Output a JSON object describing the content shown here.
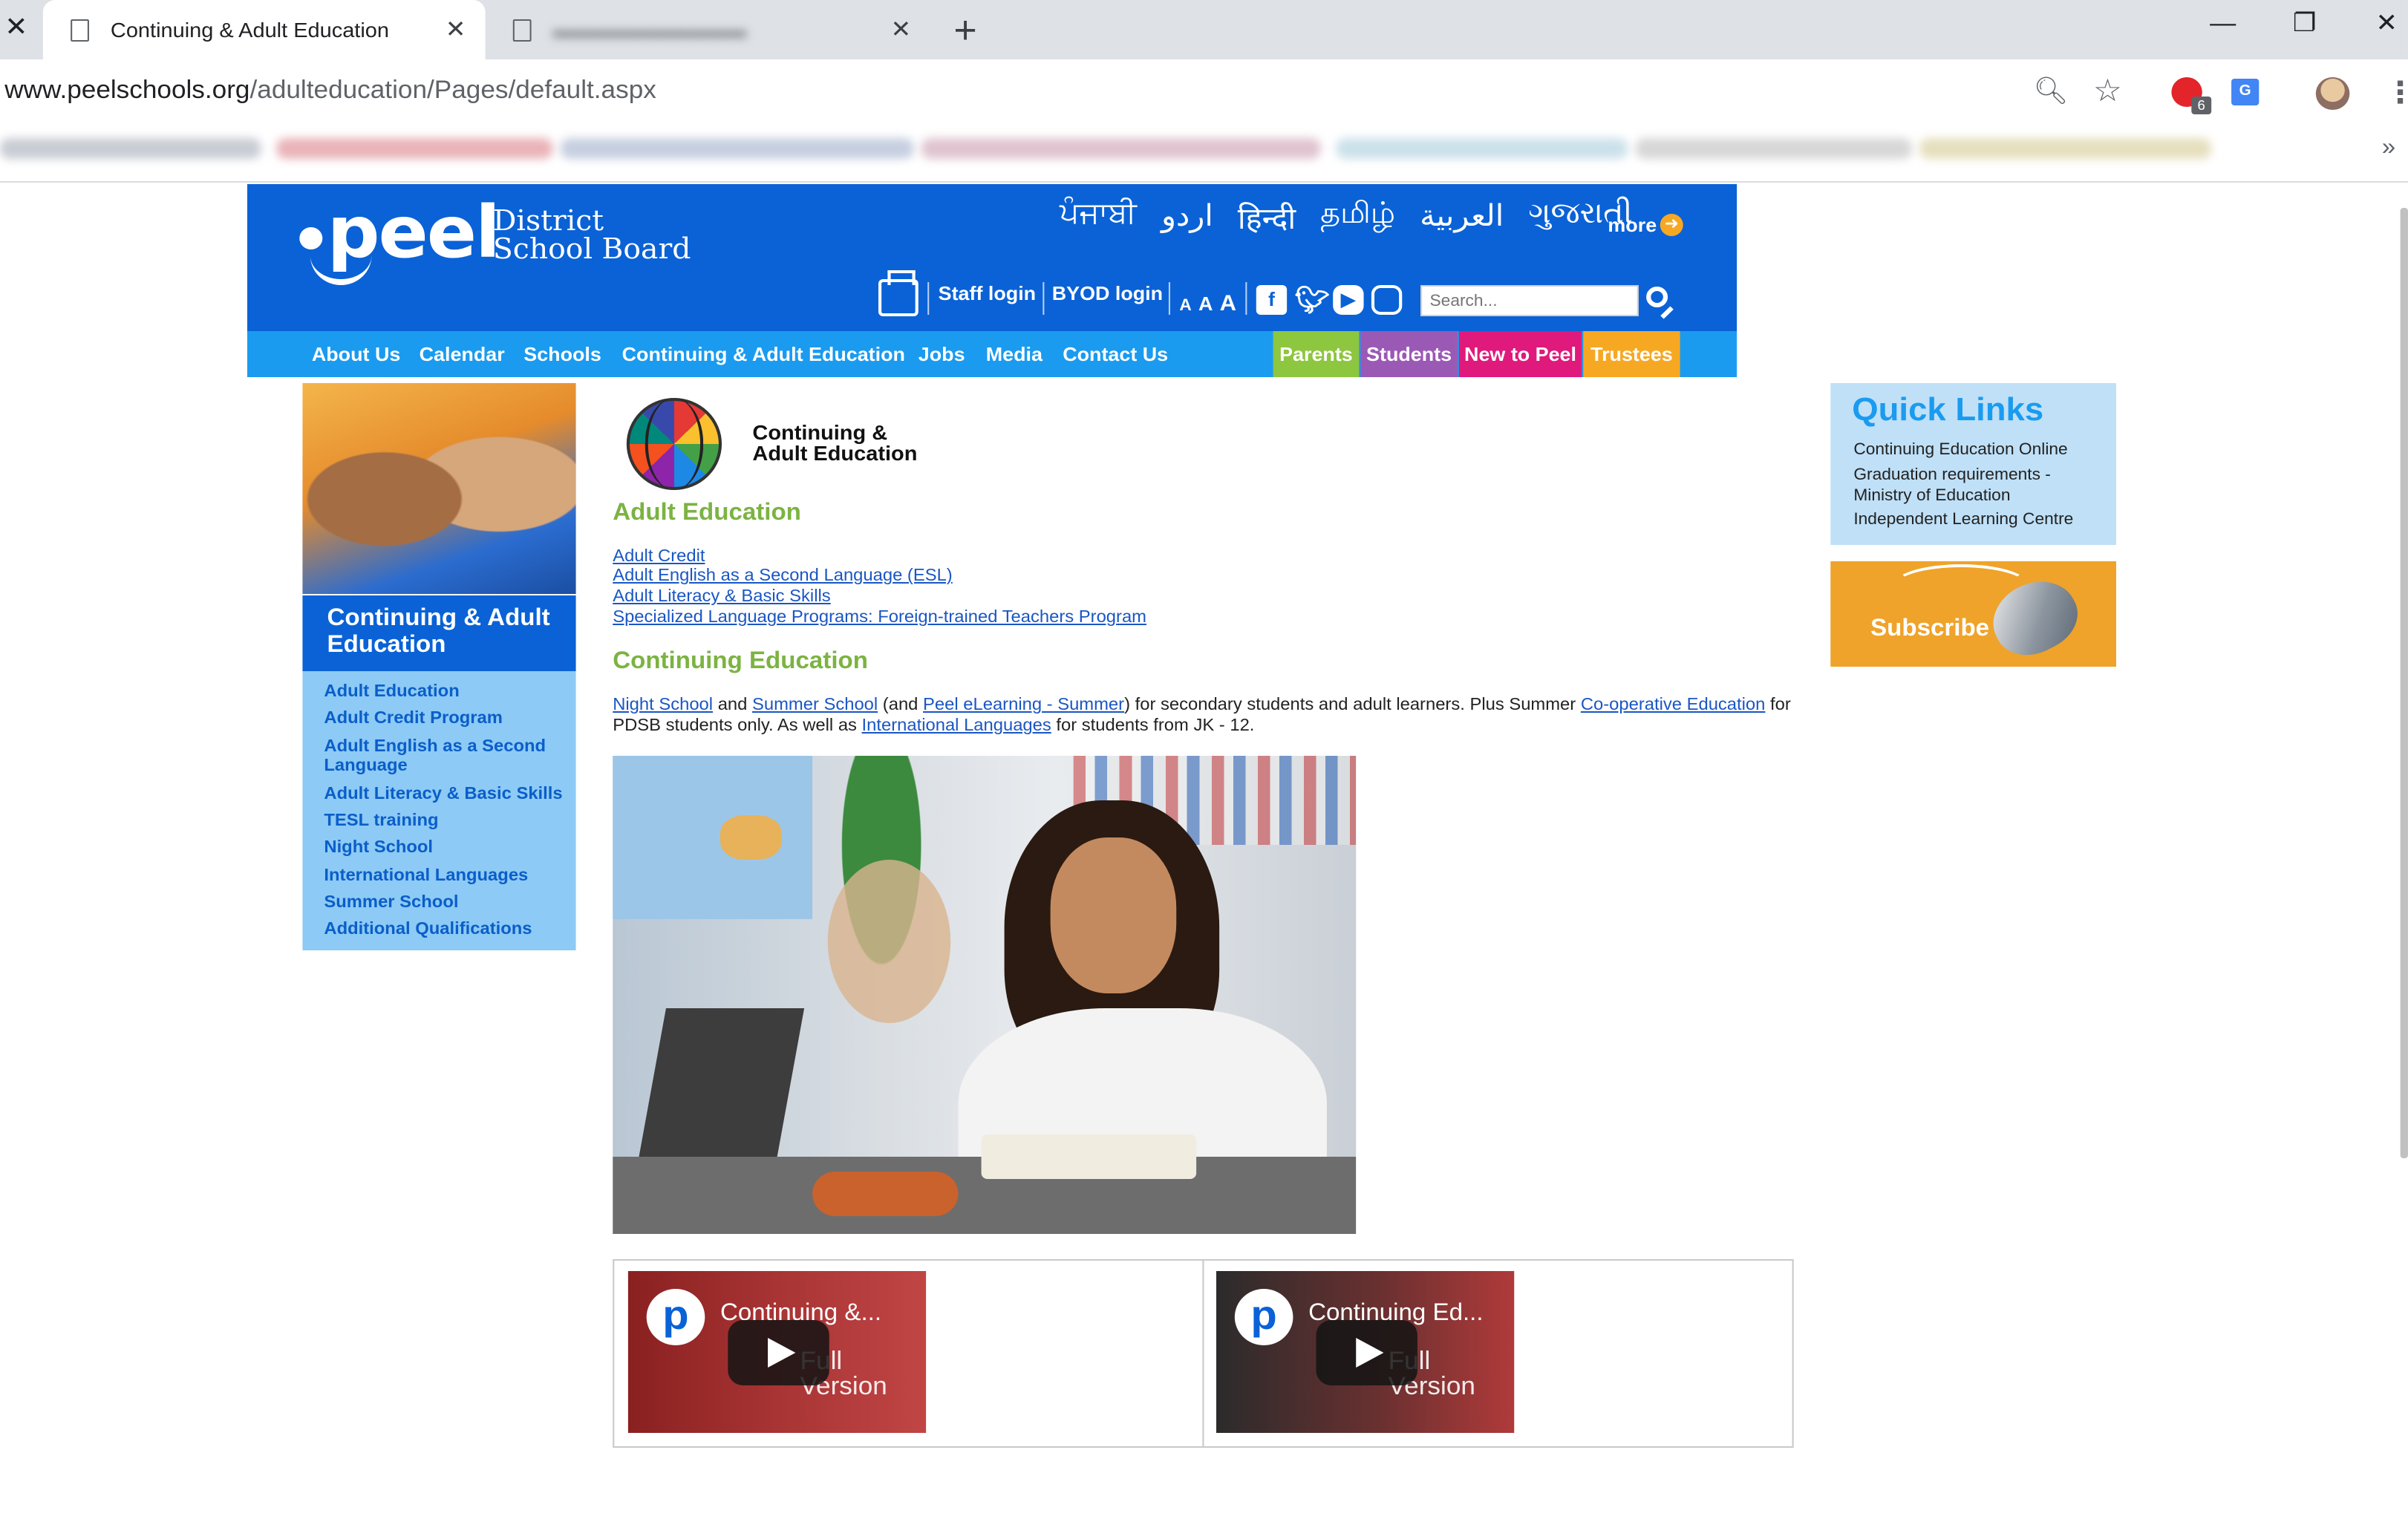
{
  "browser": {
    "tabs": [
      {
        "title": "Continuing & Adult Education",
        "active": true
      },
      {
        "title": "",
        "active": false
      }
    ],
    "url_host": "www.peelschools.org",
    "url_path": "/adulteducation/Pages/default.aspx",
    "extension_badge": "6",
    "translate_label": "G"
  },
  "header": {
    "logo_word": "peel",
    "logo_sub_1": "District",
    "logo_sub_2": "School Board",
    "languages": [
      "ਪੰਜਾਬੀ",
      "اردو",
      "हिन्दी",
      "தமிழ்",
      "العربية",
      "ગુજરાતી"
    ],
    "more_label": "more",
    "staff_login": "Staff login",
    "byod_login": "BYOD login",
    "text_size": [
      "A",
      "A",
      "A"
    ],
    "search_placeholder": "Search..."
  },
  "nav": {
    "links": [
      "About Us",
      "Calendar",
      "Schools",
      "Continuing & Adult Education",
      "Jobs",
      "Media",
      "Contact Us"
    ],
    "audiences": [
      {
        "label": "Parents",
        "color": "#8dc63f"
      },
      {
        "label": "Students",
        "color": "#9b59b6"
      },
      {
        "label": "New to Peel",
        "color": "#e0197d"
      },
      {
        "label": "Trustees",
        "color": "#f7a823"
      }
    ]
  },
  "sidebar": {
    "title": "Continuing & Adult Education",
    "items": [
      "Adult Education",
      "Adult Credit Program",
      "Adult English as a Second Language",
      "Adult Literacy & Basic Skills",
      "TESL training",
      "Night School",
      "International Languages",
      "Summer School",
      "Additional Qualifications"
    ]
  },
  "main": {
    "brand_line1": "Continuing &",
    "brand_line2": "Adult Education",
    "adult_heading": "Adult Education",
    "adult_links": [
      "Adult Credit",
      "Adult English as a Second Language (ESL)",
      "Adult Literacy & Basic Skills",
      "Specialized Language Programs: Foreign-trained Teachers Program"
    ],
    "continuing_heading": "Continuing Education",
    "para": {
      "link_night": "Night School",
      "t1": " and ",
      "link_summer": "Summer School",
      "t2": " (and ",
      "link_elearning": "Peel eLearning - Summer",
      "t3": ") for secondary students and adult learners.  Plus Summer ",
      "link_coop": "Co-operative Education",
      "t4": " for PDSB students only.  As well as ",
      "link_intl": "International Languages",
      "t5": " for students from JK - 12."
    },
    "videos": [
      {
        "logo": "p",
        "title": "Continuing &...",
        "subtitle_1": "Full",
        "subtitle_2": "Version"
      },
      {
        "logo": "p",
        "title": "Continuing Ed...",
        "subtitle_1": "Full",
        "subtitle_2": "Version"
      }
    ]
  },
  "quick_links": {
    "title": "Quick Links",
    "items": [
      "Continuing Education Online",
      "Graduation requirements -",
      "Ministry of Education",
      "Independent Learning Centre"
    ]
  },
  "subscribe": {
    "label": "Subscribe"
  }
}
